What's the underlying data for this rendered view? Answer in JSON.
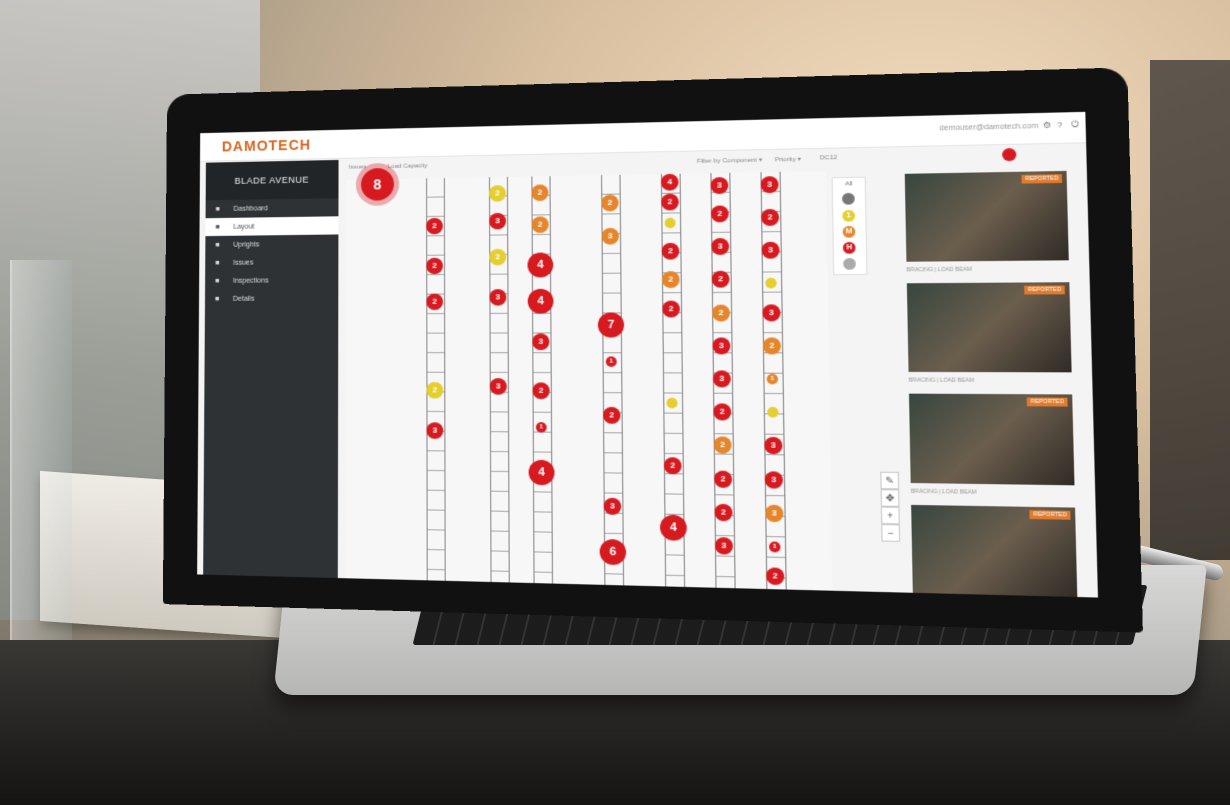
{
  "app": {
    "logo": "DAMOTECH",
    "user_email": "demouser@damotech.com",
    "project": "BLADE AVENUE"
  },
  "nav": [
    {
      "label": "Dashboard",
      "icon": "home-icon",
      "active": false
    },
    {
      "label": "Layout",
      "icon": "pin-icon",
      "active": true
    },
    {
      "label": "Uprights",
      "icon": "grid-icon",
      "active": false
    },
    {
      "label": "Issues",
      "icon": "list-icon",
      "active": false
    },
    {
      "label": "Inspections",
      "icon": "folder-icon",
      "active": false
    },
    {
      "label": "Details",
      "icon": "gear-icon",
      "active": false
    }
  ],
  "toolbar": {
    "issues_label": "Issues",
    "capacity_label": "Load Capacity",
    "filter_label": "Filter by Component ▾",
    "priority_label": "Priority ▾",
    "search_label": "DC12"
  },
  "legend": {
    "title": "All",
    "levels": [
      "",
      "1",
      "M",
      "H",
      ""
    ]
  },
  "colors": {
    "red": "#d71920",
    "orange": "#e5862b",
    "yellow": "#e4cf2e",
    "accent": "#d7651f",
    "sidebar": "#2e3235"
  },
  "map_markers": [
    {
      "rack": 0,
      "y": 0.95,
      "n": "8",
      "c": "red",
      "s": 3
    },
    {
      "rack": 1,
      "y": 0.12,
      "n": "2",
      "c": "red",
      "s": 1
    },
    {
      "rack": 1,
      "y": 0.22,
      "n": "2",
      "c": "red",
      "s": 1
    },
    {
      "rack": 1,
      "y": 0.31,
      "n": "2",
      "c": "red",
      "s": 1
    },
    {
      "rack": 1,
      "y": 0.53,
      "n": "2",
      "c": "yellow",
      "s": 1
    },
    {
      "rack": 1,
      "y": 0.63,
      "n": "3",
      "c": "red",
      "s": 1
    },
    {
      "rack": 2,
      "y": 0.04,
      "n": "2",
      "c": "yellow",
      "s": 1
    },
    {
      "rack": 2,
      "y": 0.11,
      "n": "3",
      "c": "red",
      "s": 1
    },
    {
      "rack": 2,
      "y": 0.2,
      "n": "2",
      "c": "yellow",
      "s": 1
    },
    {
      "rack": 2,
      "y": 0.3,
      "n": "3",
      "c": "red",
      "s": 1
    },
    {
      "rack": 2,
      "y": 0.52,
      "n": "3",
      "c": "red",
      "s": 1
    },
    {
      "rack": 3,
      "y": 0.04,
      "n": "2",
      "c": "orange",
      "s": 1
    },
    {
      "rack": 3,
      "y": 0.12,
      "n": "2",
      "c": "orange",
      "s": 1
    },
    {
      "rack": 3,
      "y": 0.22,
      "n": "4",
      "c": "red",
      "s": 2
    },
    {
      "rack": 3,
      "y": 0.31,
      "n": "4",
      "c": "red",
      "s": 2
    },
    {
      "rack": 3,
      "y": 0.41,
      "n": "3",
      "c": "red",
      "s": 1
    },
    {
      "rack": 3,
      "y": 0.53,
      "n": "2",
      "c": "red",
      "s": 1
    },
    {
      "rack": 3,
      "y": 0.62,
      "n": "1",
      "c": "red",
      "s": 0
    },
    {
      "rack": 3,
      "y": 0.73,
      "n": "4",
      "c": "red",
      "s": 2
    },
    {
      "rack": 4,
      "y": 0.07,
      "n": "2",
      "c": "orange",
      "s": 1
    },
    {
      "rack": 4,
      "y": 0.15,
      "n": "3",
      "c": "orange",
      "s": 1
    },
    {
      "rack": 4,
      "y": 0.37,
      "n": "7",
      "c": "red",
      "s": 2
    },
    {
      "rack": 4,
      "y": 0.46,
      "n": "1",
      "c": "red",
      "s": 0
    },
    {
      "rack": 4,
      "y": 0.59,
      "n": "2",
      "c": "red",
      "s": 1
    },
    {
      "rack": 4,
      "y": 0.81,
      "n": "3",
      "c": "red",
      "s": 1
    },
    {
      "rack": 4,
      "y": 0.92,
      "n": "6",
      "c": "red",
      "s": 2
    },
    {
      "rack": 5,
      "y": 0.02,
      "n": "4",
      "c": "red",
      "s": 1
    },
    {
      "rack": 5,
      "y": 0.07,
      "n": "2",
      "c": "red",
      "s": 1
    },
    {
      "rack": 5,
      "y": 0.12,
      "n": "",
      "c": "yellow",
      "s": 0
    },
    {
      "rack": 5,
      "y": 0.19,
      "n": "2",
      "c": "red",
      "s": 1
    },
    {
      "rack": 5,
      "y": 0.26,
      "n": "2",
      "c": "orange",
      "s": 1
    },
    {
      "rack": 5,
      "y": 0.33,
      "n": "2",
      "c": "red",
      "s": 1
    },
    {
      "rack": 5,
      "y": 0.56,
      "n": "",
      "c": "yellow",
      "s": 0
    },
    {
      "rack": 5,
      "y": 0.71,
      "n": "2",
      "c": "red",
      "s": 1
    },
    {
      "rack": 5,
      "y": 0.86,
      "n": "4",
      "c": "red",
      "s": 2
    },
    {
      "rack": 6,
      "y": 0.03,
      "n": "3",
      "c": "red",
      "s": 1
    },
    {
      "rack": 6,
      "y": 0.1,
      "n": "2",
      "c": "red",
      "s": 1
    },
    {
      "rack": 6,
      "y": 0.18,
      "n": "3",
      "c": "red",
      "s": 1
    },
    {
      "rack": 6,
      "y": 0.26,
      "n": "2",
      "c": "red",
      "s": 1
    },
    {
      "rack": 6,
      "y": 0.34,
      "n": "2",
      "c": "orange",
      "s": 1
    },
    {
      "rack": 6,
      "y": 0.42,
      "n": "3",
      "c": "red",
      "s": 1
    },
    {
      "rack": 6,
      "y": 0.5,
      "n": "3",
      "c": "red",
      "s": 1
    },
    {
      "rack": 6,
      "y": 0.58,
      "n": "2",
      "c": "red",
      "s": 1
    },
    {
      "rack": 6,
      "y": 0.66,
      "n": "2",
      "c": "orange",
      "s": 1
    },
    {
      "rack": 6,
      "y": 0.74,
      "n": "2",
      "c": "red",
      "s": 1
    },
    {
      "rack": 6,
      "y": 0.82,
      "n": "2",
      "c": "red",
      "s": 1
    },
    {
      "rack": 6,
      "y": 0.9,
      "n": "3",
      "c": "red",
      "s": 1
    },
    {
      "rack": 7,
      "y": 0.03,
      "n": "3",
      "c": "red",
      "s": 1
    },
    {
      "rack": 7,
      "y": 0.11,
      "n": "2",
      "c": "red",
      "s": 1
    },
    {
      "rack": 7,
      "y": 0.19,
      "n": "3",
      "c": "red",
      "s": 1
    },
    {
      "rack": 7,
      "y": 0.27,
      "n": "",
      "c": "yellow",
      "s": 0
    },
    {
      "rack": 7,
      "y": 0.34,
      "n": "3",
      "c": "red",
      "s": 1
    },
    {
      "rack": 7,
      "y": 0.42,
      "n": "2",
      "c": "orange",
      "s": 1
    },
    {
      "rack": 7,
      "y": 0.5,
      "n": "1",
      "c": "orange",
      "s": 0
    },
    {
      "rack": 7,
      "y": 0.58,
      "n": "",
      "c": "yellow",
      "s": 0
    },
    {
      "rack": 7,
      "y": 0.66,
      "n": "3",
      "c": "red",
      "s": 1
    },
    {
      "rack": 7,
      "y": 0.74,
      "n": "3",
      "c": "red",
      "s": 1
    },
    {
      "rack": 7,
      "y": 0.82,
      "n": "3",
      "c": "orange",
      "s": 1
    },
    {
      "rack": 7,
      "y": 0.9,
      "n": "1",
      "c": "red",
      "s": 0
    },
    {
      "rack": 7,
      "y": 0.97,
      "n": "2",
      "c": "red",
      "s": 1
    }
  ],
  "photos": [
    {
      "badge": "REPORTED",
      "caption": "BRACING | LOAD BEAM",
      "ic": "photo-1"
    },
    {
      "badge": "REPORTED",
      "caption": "BRACING | LOAD BEAM",
      "ic": "photo-2"
    },
    {
      "badge": "REPORTED",
      "caption": "BRACING | LOAD BEAM",
      "ic": "photo-3"
    },
    {
      "badge": "REPORTED",
      "caption": "",
      "ic": "photo-4"
    }
  ]
}
